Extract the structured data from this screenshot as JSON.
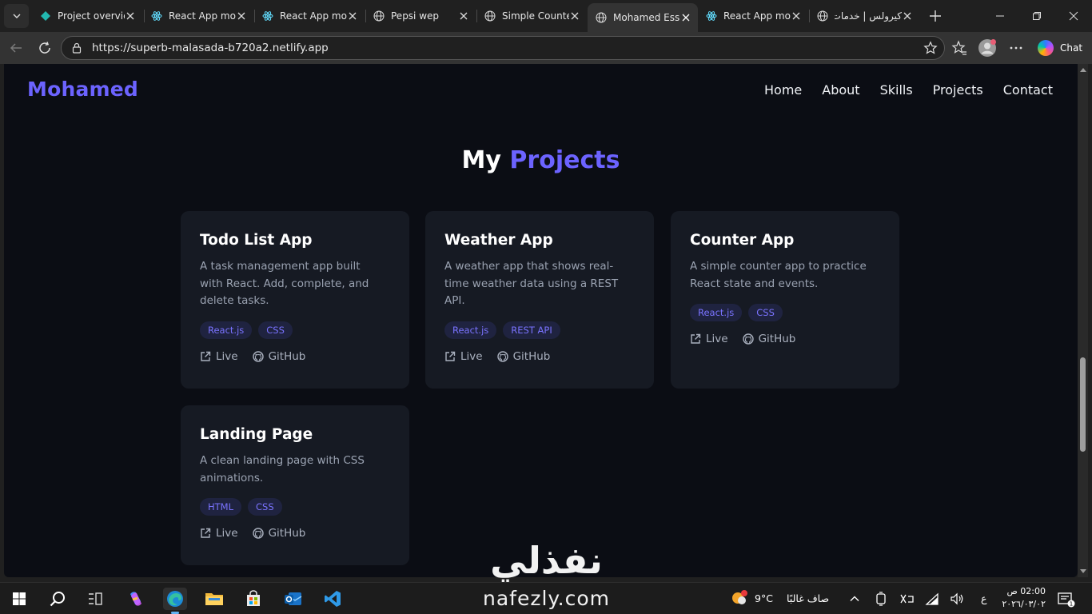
{
  "browser": {
    "tabs": [
      {
        "label": "Project overview",
        "icon": "gem-icon"
      },
      {
        "label": "React App moo",
        "icon": "react-icon"
      },
      {
        "label": "React App moo",
        "icon": "react-icon"
      },
      {
        "label": "Pepsi wep",
        "icon": "globe-icon"
      },
      {
        "label": "Simple Counter",
        "icon": "globe-icon"
      },
      {
        "label": "Mohamed Essa",
        "icon": "globe-icon",
        "active": true
      },
      {
        "label": "React App moo",
        "icon": "react-icon"
      },
      {
        "label": "كيرولس | خدمات",
        "icon": "globe-icon"
      }
    ],
    "url": "https://superb-malasada-b720a2.netlify.app",
    "chat_label": "Chat"
  },
  "site": {
    "logo": "Mohamed",
    "nav": [
      "Home",
      "About",
      "Skills",
      "Projects",
      "Contact"
    ],
    "section_title_1": "My",
    "section_title_2": "Projects",
    "projects": [
      {
        "title": "Todo List App",
        "description": "A task management app built with React. Add, complete, and delete tasks.",
        "tags": [
          "React.js",
          "CSS"
        ],
        "live": "Live",
        "github": "GitHub"
      },
      {
        "title": "Weather App",
        "description": "A weather app that shows real-time weather data using a REST API.",
        "tags": [
          "React.js",
          "REST API"
        ],
        "live": "Live",
        "github": "GitHub"
      },
      {
        "title": "Counter App",
        "description": "A simple counter app to practice React state and events.",
        "tags": [
          "React.js",
          "CSS"
        ],
        "live": "Live",
        "github": "GitHub"
      },
      {
        "title": "Landing Page",
        "description": "A clean landing page with CSS animations.",
        "tags": [
          "HTML",
          "CSS"
        ],
        "live": "Live",
        "github": "GitHub"
      }
    ]
  },
  "watermark": {
    "arabic": "نفذلي",
    "latin": "nafezly.com"
  },
  "taskbar": {
    "weather_temp": "9°C",
    "weather_text": "صاف غالبًا",
    "lang": "ع",
    "time": "02:00 ص",
    "date": "٢٠٢٦/٠٣/٠٢"
  },
  "colors": {
    "accent": "#6c63ff",
    "page_bg": "#0b0d14",
    "card_bg": "#161a23",
    "tag_bg": "#1f2340"
  }
}
